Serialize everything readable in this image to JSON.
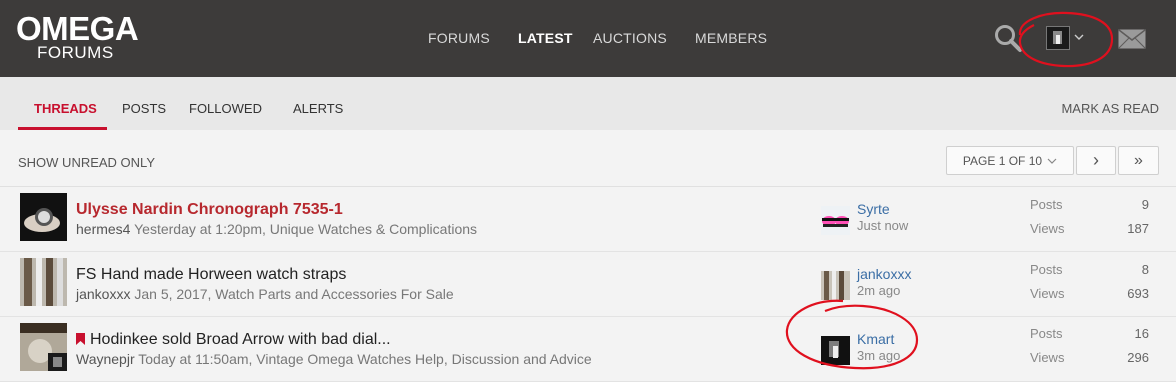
{
  "logo": {
    "line1": "OMEGA",
    "line2": "FORUMS"
  },
  "nav": [
    {
      "label": "FORUMS",
      "active": false
    },
    {
      "label": "LATEST",
      "active": true
    },
    {
      "label": "AUCTIONS",
      "active": false
    },
    {
      "label": "MEMBERS",
      "active": false
    }
  ],
  "header_icons": [
    "search-icon",
    "avatar",
    "chevron-down-icon",
    "mail-icon"
  ],
  "tabs": [
    {
      "label": "THREADS",
      "active": true
    },
    {
      "label": "POSTS",
      "active": false
    },
    {
      "label": "FOLLOWED",
      "active": false
    },
    {
      "label": "ALERTS",
      "active": false
    }
  ],
  "mark_read": "MARK AS READ",
  "show_unread": "SHOW UNREAD ONLY",
  "pager": {
    "label": "PAGE 1 OF 10",
    "next": "›",
    "last": "»"
  },
  "colors": {
    "accent": "#c8102e",
    "header_bg": "#3d3b3a",
    "annotation": "#e0101e",
    "link": "#3b6ea5"
  },
  "threads": [
    {
      "title": "Ulysse Nardin Chronograph 7535-1",
      "prefix": "",
      "bookmarked": false,
      "hot": true,
      "author": "hermes4",
      "meta": " Yesterday at 1:20pm, Unique Watches & Complications",
      "last_user": "Syrte",
      "last_time": "Just now",
      "posts_label": "Posts",
      "posts": "9",
      "views_label": "Views",
      "views": "187"
    },
    {
      "title": "Hand made Horween watch straps",
      "prefix": "FS ",
      "bookmarked": false,
      "hot": false,
      "author": "jankoxxx",
      "meta": " Jan 5, 2017, Watch Parts and Accessories For Sale",
      "last_user": "jankoxxx",
      "last_time": "2m ago",
      "posts_label": "Posts",
      "posts": "8",
      "views_label": "Views",
      "views": "693"
    },
    {
      "title": "Hodinkee sold Broad Arrow with bad dial...",
      "prefix": "",
      "bookmarked": true,
      "hot": false,
      "author": "Waynepjr",
      "meta": " Today at 11:50am, Vintage Omega Watches Help, Discussion and Advice",
      "last_user": "Kmart",
      "last_time": "3m ago",
      "posts_label": "Posts",
      "posts": "16",
      "views_label": "Views",
      "views": "296"
    }
  ]
}
